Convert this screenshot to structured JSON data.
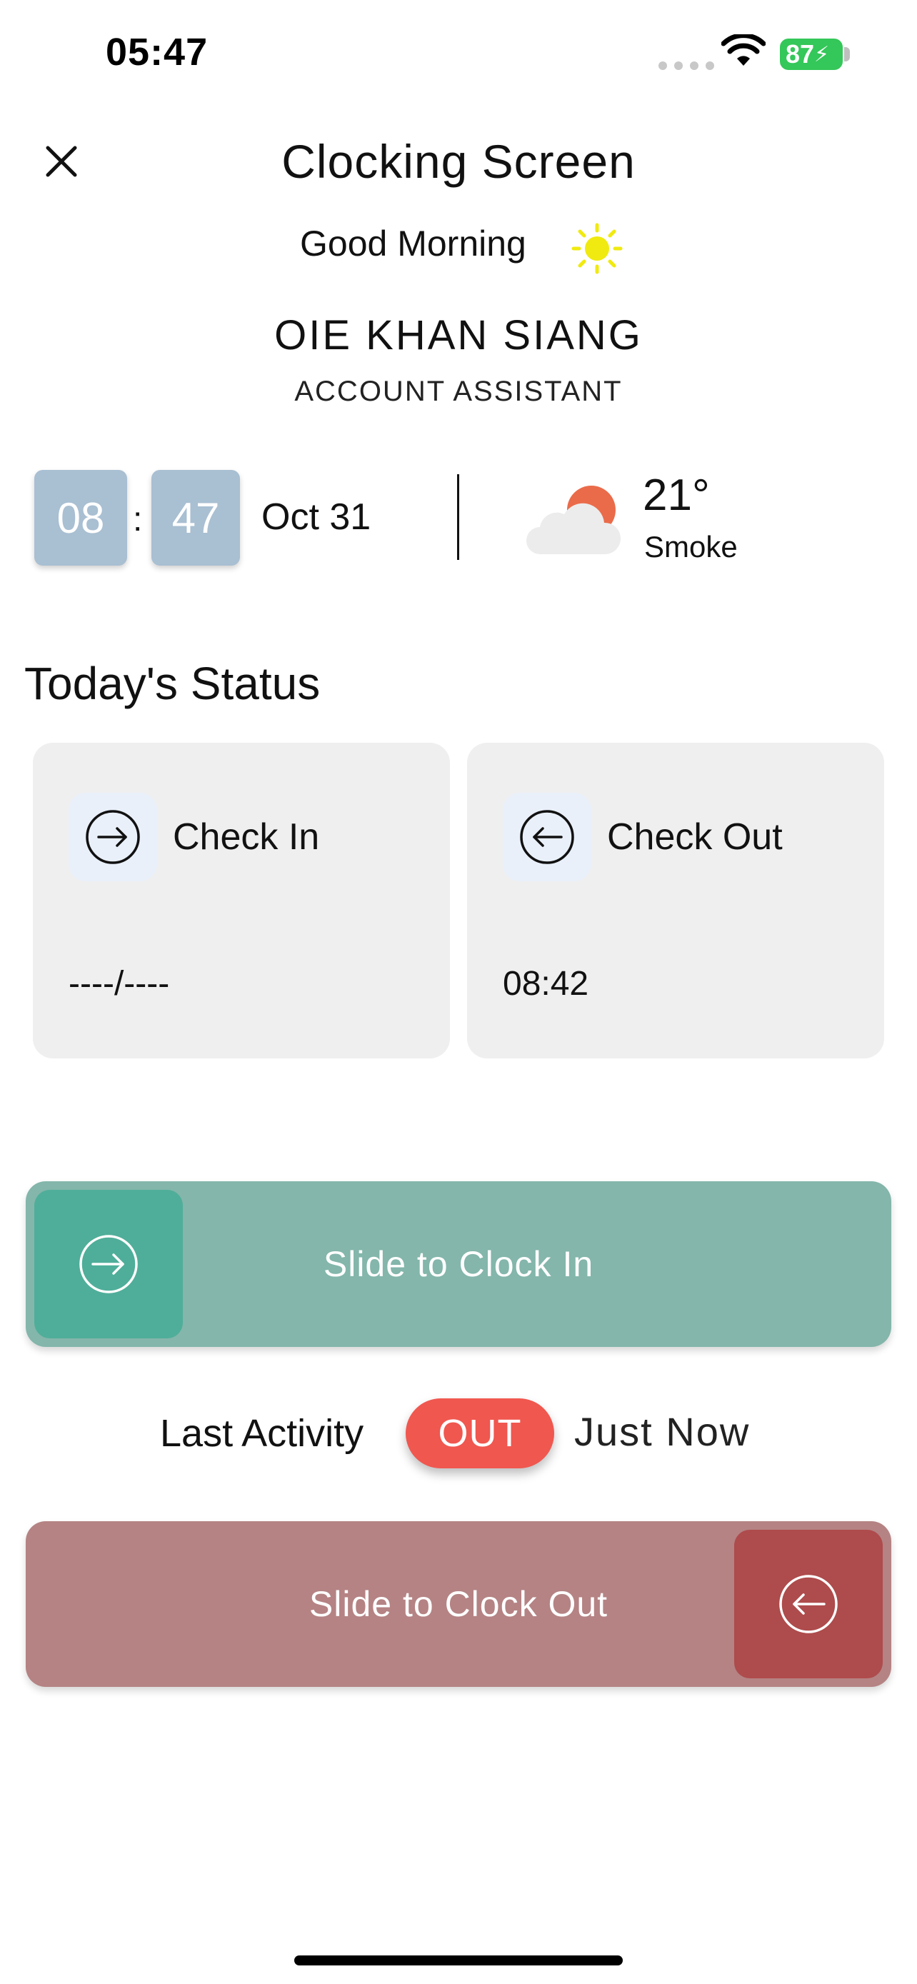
{
  "status_bar": {
    "time": "05:47",
    "battery": "87",
    "icons": [
      "signal-dots-icon",
      "wifi-icon",
      "battery-charging-icon"
    ]
  },
  "header": {
    "title": "Clocking Screen",
    "close_icon": "close-icon"
  },
  "greeting": {
    "text": "Good Morning",
    "icon": "sun-icon"
  },
  "employee": {
    "name": "OIE KHAN SIANG",
    "role": "ACCOUNT ASSISTANT"
  },
  "clock": {
    "hours": "08",
    "separator": ":",
    "minutes": "47",
    "date": "Oct 31"
  },
  "weather": {
    "temperature": "21°",
    "condition": "Smoke",
    "icon": "cloud-sun-icon"
  },
  "todays_status": {
    "title": "Today's Status",
    "check_in": {
      "label": "Check In",
      "value": "----/----",
      "icon": "login-arrow-icon"
    },
    "check_out": {
      "label": "Check Out",
      "value": "08:42",
      "icon": "logout-arrow-icon"
    }
  },
  "clock_in_slider": {
    "label": "Slide to Clock In",
    "icon": "login-arrow-icon"
  },
  "last_activity": {
    "label": "Last Activity",
    "status": "OUT",
    "time": "Just Now"
  },
  "clock_out_slider": {
    "label": "Slide to Clock Out",
    "icon": "logout-arrow-icon"
  },
  "colors": {
    "time_box": "#a9bfd2",
    "clock_in_track": "#84b6ab",
    "clock_in_knob": "#4fae99",
    "clock_out_track": "#b58384",
    "clock_out_knob": "#ae4b4c",
    "out_pill": "#f0574f",
    "card_bg": "#efefef"
  }
}
